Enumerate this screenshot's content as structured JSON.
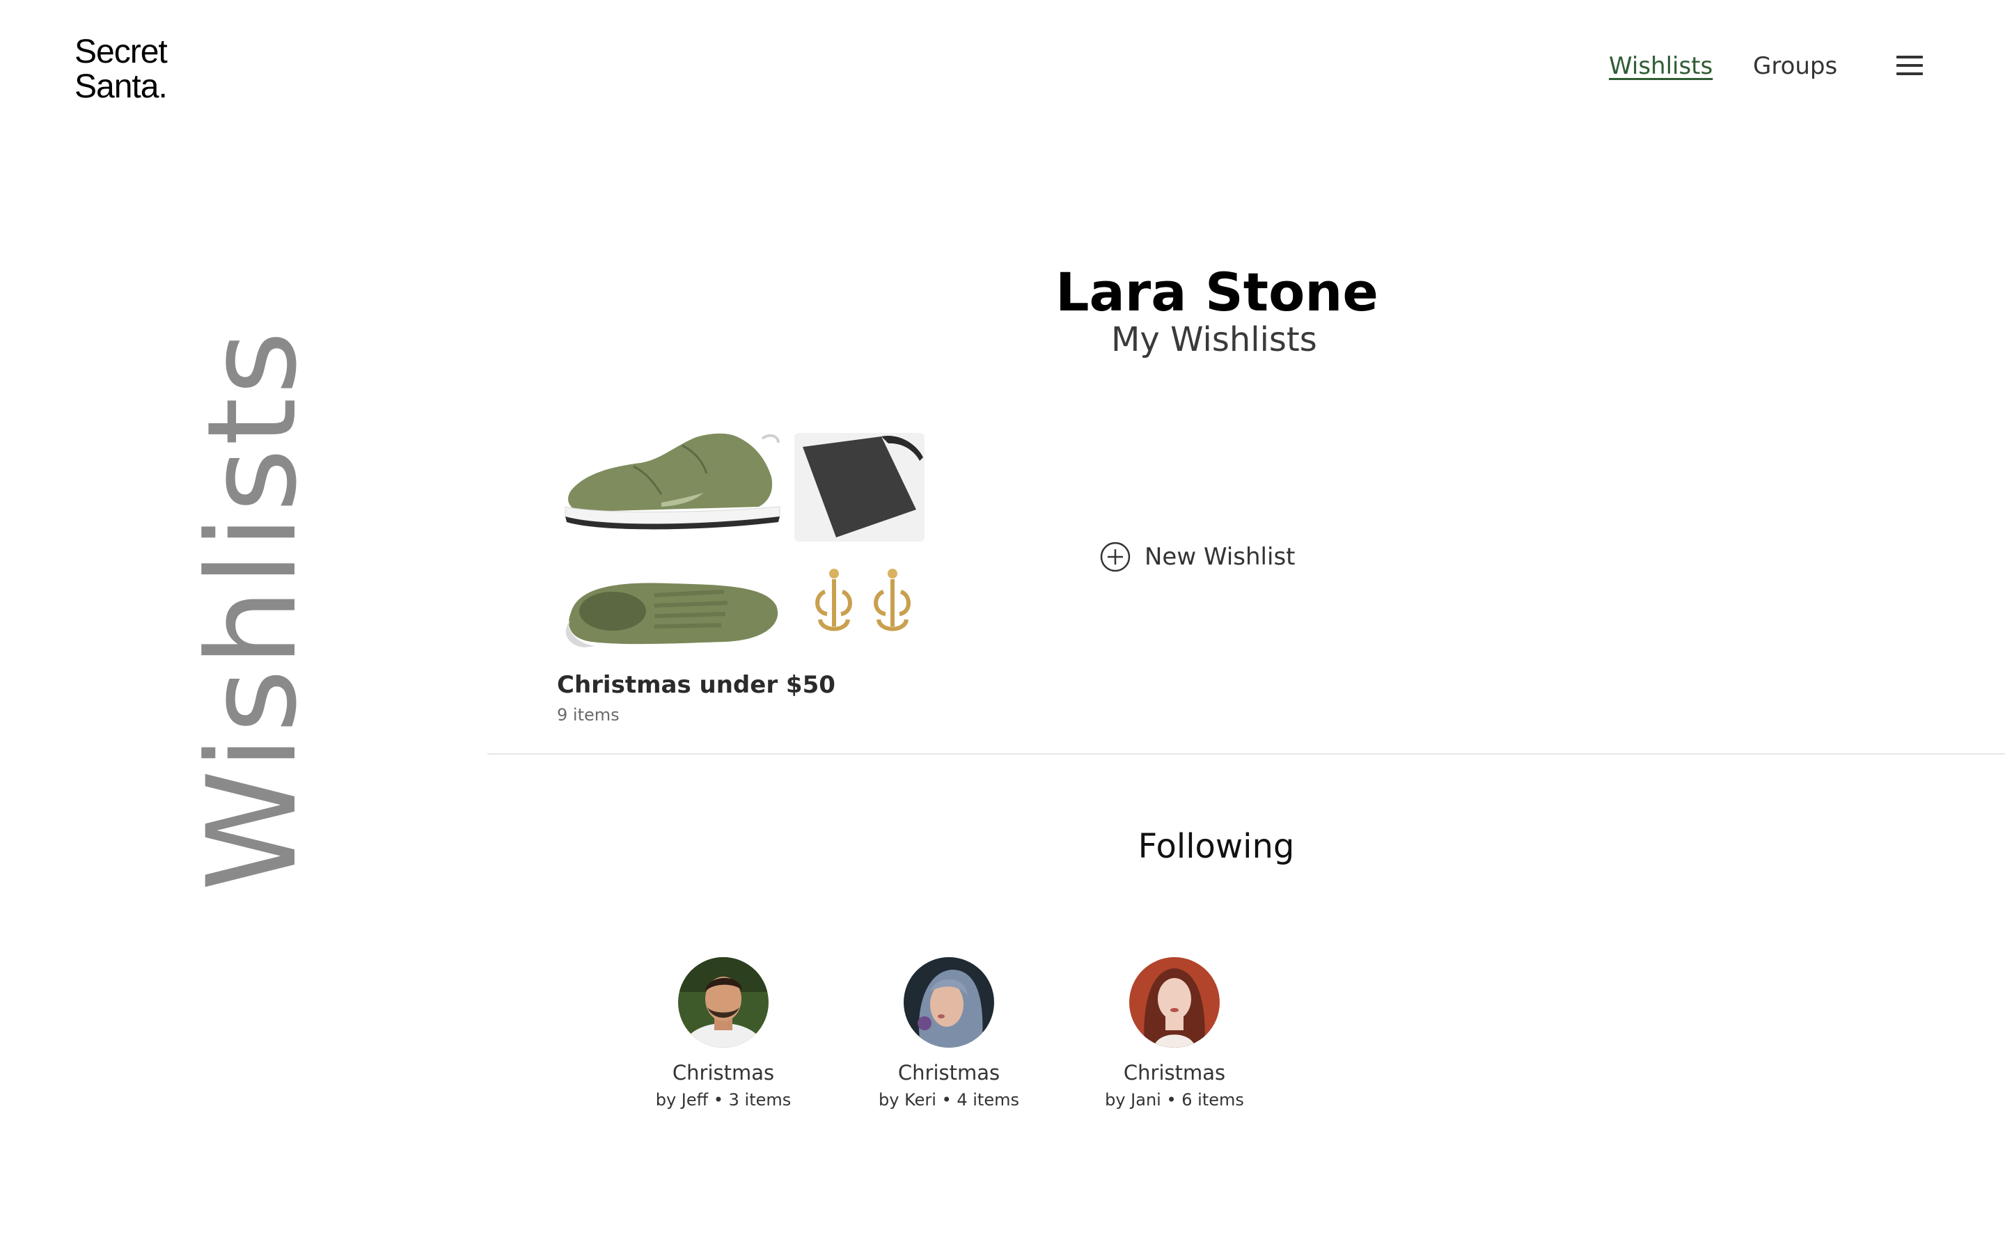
{
  "brand": {
    "line1": "Secret",
    "line2": "Santa."
  },
  "nav": {
    "wishlists": "Wishlists",
    "groups": "Groups",
    "menu_icon": "hamburger-menu-icon"
  },
  "side_title": "Wishlists",
  "profile": {
    "name": "Lara Stone",
    "subtitle": "My Wishlists"
  },
  "wishlists": [
    {
      "title": "Christmas under $50",
      "count": "9 items"
    }
  ],
  "new_wishlist": {
    "label": "New Wishlist",
    "icon": "plus-circle-icon"
  },
  "following": {
    "heading": "Following",
    "items": [
      {
        "title": "Christmas",
        "by": "by Jeff",
        "count": "3 items"
      },
      {
        "title": "Christmas",
        "by": "by Keri",
        "count": "4 items"
      },
      {
        "title": "Christmas",
        "by": "by Jani",
        "count": "6 items"
      }
    ]
  },
  "colors": {
    "accent_link": "#2f5d34",
    "side_title": "#8a8a8a",
    "divider": "#e6e6e6"
  }
}
